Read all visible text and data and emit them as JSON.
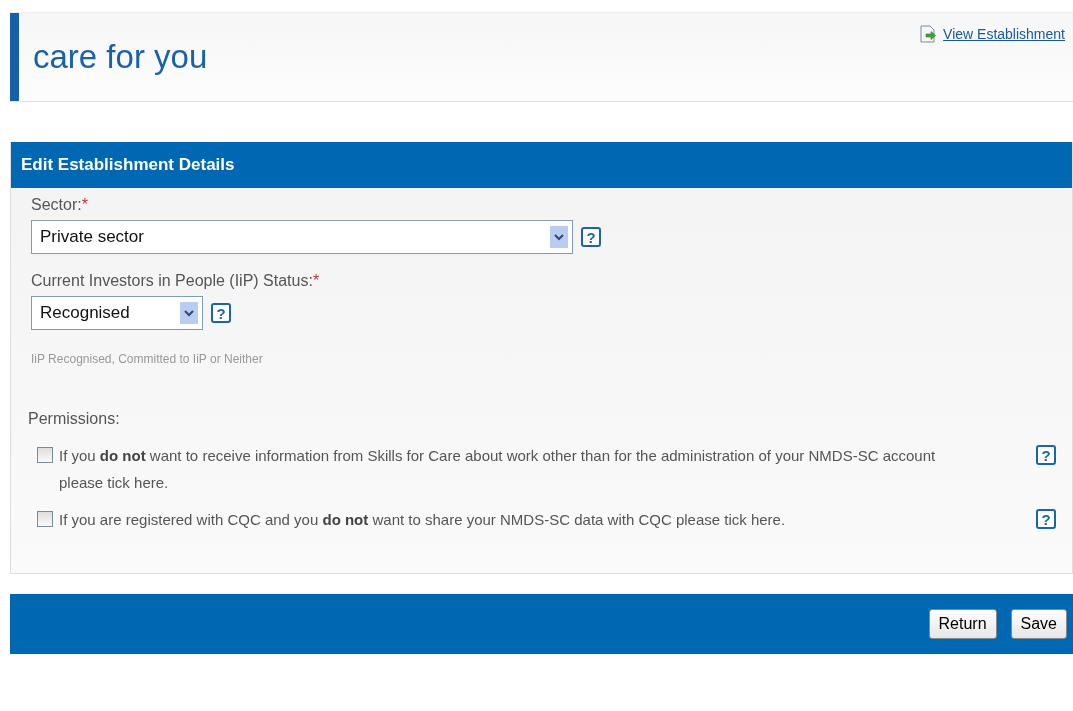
{
  "header": {
    "title": "care for you",
    "link": "View Establishment"
  },
  "panel": {
    "title": "Edit Establishment Details",
    "fields": [
      {
        "label": "Sector:",
        "required_mark": "*",
        "value": "Private sector",
        "help": "?"
      },
      {
        "label": "Current Investors in People (IiP) Status:",
        "required_mark": "*",
        "value": "Recognised",
        "help": "?",
        "hint": "IiP Recognised, Committed to IiP or Neither"
      }
    ],
    "permissions": {
      "label": "Permissions:",
      "items": [
        {
          "text": "If you **do not** want to receive information from Skills for Care about work other than for the administration of your NMDS-SC account please tick here.",
          "checked": false,
          "help": "?"
        },
        {
          "text": "If you are registered with CQC and you **do not** want to share your NMDS-SC data with CQC please tick here.",
          "checked": false,
          "help": "?"
        }
      ]
    }
  },
  "footer": {
    "buttons": [
      "Return",
      "Save"
    ]
  }
}
